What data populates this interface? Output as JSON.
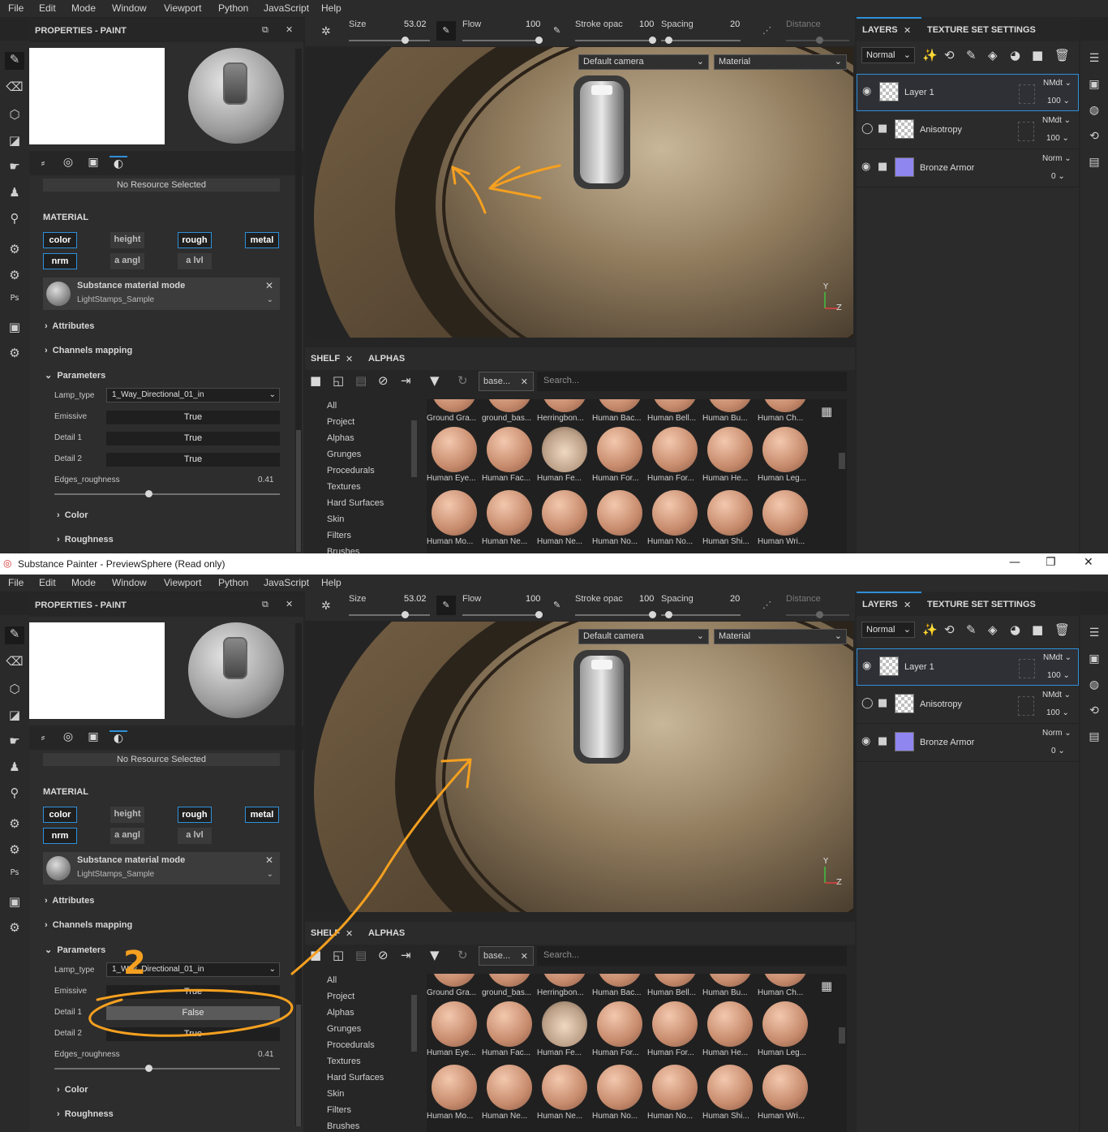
{
  "menu": [
    "File",
    "Edit",
    "Mode",
    "Window",
    "Viewport",
    "Python",
    "JavaScript",
    "Help"
  ],
  "window": {
    "title": "Substance Painter - PreviewSphere (Read only)",
    "minimize": "—",
    "restore": "❐",
    "close": "✕"
  },
  "properties": {
    "title": "PROPERTIES - PAINT",
    "no_resource": "No Resource Selected",
    "material_heading": "MATERIAL",
    "channels": [
      {
        "label": "color",
        "on": true
      },
      {
        "label": "height",
        "on": false
      },
      {
        "label": "rough",
        "on": true
      },
      {
        "label": "metal",
        "on": true
      },
      {
        "label": "nrm",
        "on": true
      },
      {
        "label": "a angl",
        "on": false
      },
      {
        "label": "a lvl",
        "on": false
      }
    ],
    "material_mode": {
      "title": "Substance material mode",
      "resource": "LightStamps_Sample"
    },
    "sections": {
      "attributes": "Attributes",
      "channels_mapping": "Channels mapping",
      "parameters": "Parameters",
      "color": "Color",
      "roughness": "Roughness"
    },
    "params": {
      "lamp_type_label": "Lamp_type",
      "lamp_type_value": "1_Way_Directional_01_in",
      "emissive_label": "Emissive",
      "detail1_label": "Detail 1",
      "detail2_label": "Detail 2",
      "edges_roughness_label": "Edges_roughness",
      "edges_roughness_value": "0.41"
    }
  },
  "panes": [
    {
      "emissive": "True",
      "detail1": "True",
      "detail2": "True"
    },
    {
      "emissive": "True",
      "detail1": "False",
      "detail2": "True"
    }
  ],
  "toolbar": {
    "size_label": "Size",
    "size_value": "53.02",
    "flow_label": "Flow",
    "flow_value": "100",
    "stroke_label": "Stroke opac",
    "stroke_value": "100",
    "spacing_label": "Spacing",
    "spacing_value": "20",
    "distance_label": "Distance"
  },
  "viewport": {
    "camera": "Default camera",
    "mode": "Material",
    "axis_y": "Y",
    "axis_z": "Z"
  },
  "shelf": {
    "tab_shelf": "SHELF",
    "tab_alphas": "ALPHAS",
    "filter_chip": "base...",
    "search_placeholder": "Search...",
    "categories": [
      "All",
      "Project",
      "Alphas",
      "Grunges",
      "Procedurals",
      "Textures",
      "Hard Surfaces",
      "Skin",
      "Filters",
      "Brushes"
    ],
    "row0": [
      "Ground Gra...",
      "ground_bas...",
      "Herringbon...",
      "Human Bac...",
      "Human Bell...",
      "Human Bu...",
      "Human Ch..."
    ],
    "row1": [
      "Human Eye...",
      "Human Fac...",
      "Human Fe...",
      "Human For...",
      "Human For...",
      "Human He...",
      "Human Leg..."
    ],
    "row2": [
      "Human Mo...",
      "Human Ne...",
      "Human Ne...",
      "Human No...",
      "Human No...",
      "Human Shi...",
      "Human Wri..."
    ]
  },
  "layers": {
    "tab_layers": "LAYERS",
    "tab_tss": "TEXTURE SET SETTINGS",
    "blend_mode": "Normal",
    "items": [
      {
        "name": "Layer 1",
        "blend": "NMdt",
        "opacity": "100"
      },
      {
        "name": "Anisotropy",
        "blend": "NMdt",
        "opacity": "100"
      },
      {
        "name": "Bronze Armor",
        "blend": "Norm",
        "opacity": "0"
      }
    ]
  },
  "annotation": {
    "step": "2"
  },
  "colors": {
    "accent": "#2f8fd8",
    "annotation": "#f5a020"
  }
}
